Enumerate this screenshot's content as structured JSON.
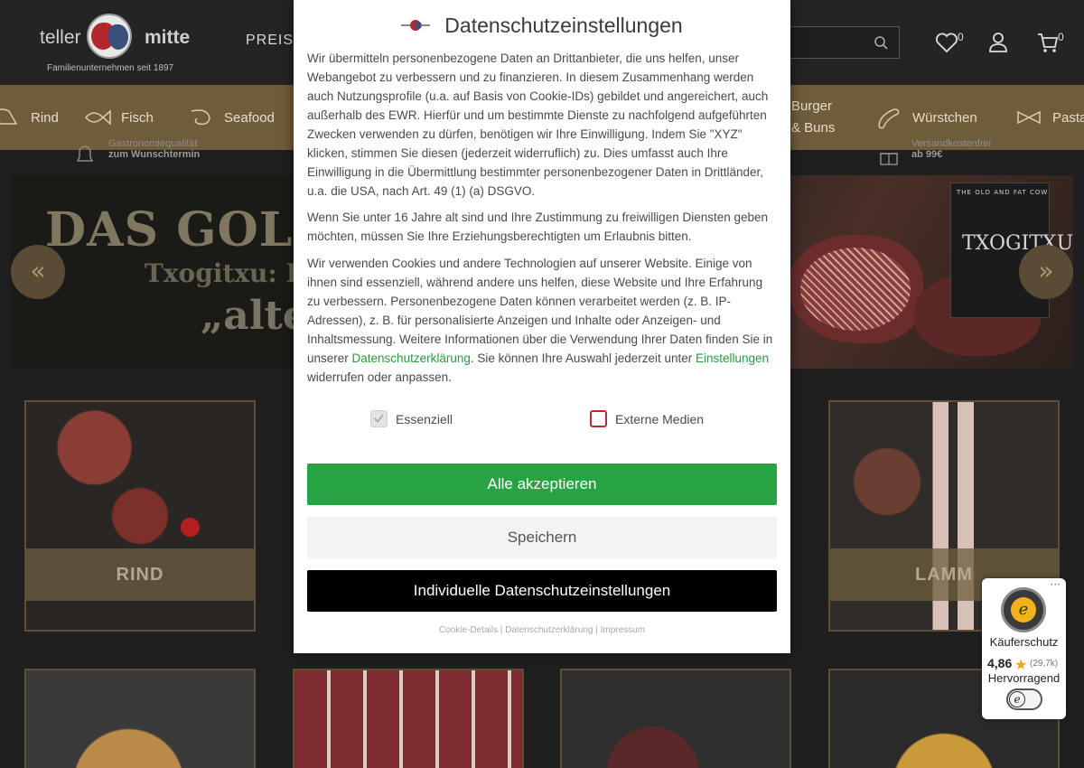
{
  "header": {
    "logo_word_left": "teller",
    "logo_word_right": "mitte",
    "logo_tagline": "Familienunternehmen seit 1897",
    "nav_preis": "PREISK",
    "wishlist_count": "0",
    "cart_count": "0"
  },
  "categories": [
    {
      "label": "Rind",
      "icon": "cow-icon"
    },
    {
      "label": "Fisch",
      "icon": "fish-icon"
    },
    {
      "label": "Seafood",
      "icon": "shrimp-icon"
    },
    {
      "label_line1": "Burger",
      "label_line2": "& Buns",
      "icon": "burger-icon"
    },
    {
      "label": "Würstchen",
      "icon": "sausage-icon"
    },
    {
      "label": "Pasta",
      "icon": "pasta-icon"
    }
  ],
  "usp": {
    "left_line1": "Gastronomiequalität",
    "left_line2": "zum Wunschtermin",
    "right_line1": "Versandkostenfrei",
    "right_line2": "ab 99€"
  },
  "hero": {
    "headline": "DAS GOLD",
    "subline": "Txogitxu: D",
    "quote": "„alte",
    "box_top": "THE OLD AND FAT COW",
    "box_brand": "TXOGITXU",
    "prev_label": "«",
    "next_label": "»"
  },
  "tiles": [
    {
      "label": "RIND"
    },
    {
      "label": "LAMM"
    }
  ],
  "modal": {
    "title": "Datenschutzeinstellungen",
    "p1": "Wir übermitteln personenbezogene Daten an Drittanbieter, die uns helfen, unser Webangebot zu verbessern und zu finanzieren. In diesem Zusammenhang werden auch Nutzungsprofile (u.a. auf Basis von Cookie-IDs) gebildet und angereichert, auch außerhalb des EWR. Hierfür und um bestimmte Dienste zu nachfolgend aufgeführten Zwecken verwenden zu dürfen, benötigen wir Ihre Einwilligung. Indem Sie \"XYZ\" klicken, stimmen Sie diesen (jederzeit widerruflich) zu. Dies umfasst auch Ihre Einwilligung in die Übermittlung bestimmter personenbezogener Daten in Drittländer, u.a. die USA, nach Art. 49 (1) (a) DSGVO.",
    "p2": "Wenn Sie unter 16 Jahre alt sind und Ihre Zustimmung zu freiwilligen Diensten geben möchten, müssen Sie Ihre Erziehungsberechtigten um Erlaubnis bitten.",
    "p3_a": "Wir verwenden Cookies und andere Technologien auf unserer Website. Einige von ihnen sind essenziell, während andere uns helfen, diese Website und Ihre Erfahrung zu verbessern. Personenbezogene Daten können verarbeitet werden (z. B. IP-Adressen), z. B. für personalisierte Anzeigen und Inhalte oder Anzeigen- und Inhaltsmessung. Weitere Informationen über die Verwendung Ihrer Daten finden Sie in unserer ",
    "p3_link1": "Datenschutzerklärung",
    "p3_b": ". Sie können Ihre Auswahl jederzeit unter ",
    "p3_link2": "Einstellungen",
    "p3_c": " widerrufen oder anpassen.",
    "check_essential": "Essenziell",
    "check_external": "Externe Medien",
    "btn_accept": "Alle akzeptieren",
    "btn_save": "Speichern",
    "btn_individual": "Individuelle Datenschutzeinstellungen",
    "footer_cookie": "Cookie-Details",
    "footer_privacy": "Datenschutzerklärung",
    "footer_imprint": "Impressum",
    "footer_sep": "|"
  },
  "trusted_shops": {
    "title": "Käuferschutz",
    "score": "4,86",
    "count": "(29,7k)",
    "grade": "Hervorragend",
    "menu": "···"
  },
  "colors": {
    "accept_green": "#27a344",
    "link_green": "#2a9a3c",
    "category_bar": "#6f5c3a",
    "page_bg": "#1f1f1f"
  }
}
